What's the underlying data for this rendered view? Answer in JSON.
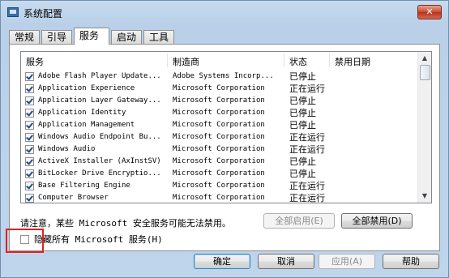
{
  "window": {
    "title": "系统配置",
    "close_label": "✕"
  },
  "tabs": [
    {
      "label": "常规",
      "active": false
    },
    {
      "label": "引导",
      "active": false
    },
    {
      "label": "服务",
      "active": true
    },
    {
      "label": "启动",
      "active": false
    },
    {
      "label": "工具",
      "active": false
    }
  ],
  "columns": {
    "service": "服务",
    "manufacturer": "制造商",
    "status": "状态",
    "disabled_date": "禁用日期"
  },
  "rows": [
    {
      "name": "Adobe Flash Player Update...",
      "manufacturer": "Adobe Systems Incorp...",
      "status": "已停止",
      "checked": true
    },
    {
      "name": "Application Experience",
      "manufacturer": "Microsoft Corporation",
      "status": "正在运行",
      "checked": true
    },
    {
      "name": "Application Layer Gateway...",
      "manufacturer": "Microsoft Corporation",
      "status": "已停止",
      "checked": true
    },
    {
      "name": "Application Identity",
      "manufacturer": "Microsoft Corporation",
      "status": "已停止",
      "checked": true
    },
    {
      "name": "Application Management",
      "manufacturer": "Microsoft Corporation",
      "status": "已停止",
      "checked": true
    },
    {
      "name": "Windows Audio Endpoint Bu...",
      "manufacturer": "Microsoft Corporation",
      "status": "正在运行",
      "checked": true
    },
    {
      "name": "Windows Audio",
      "manufacturer": "Microsoft Corporation",
      "status": "正在运行",
      "checked": true
    },
    {
      "name": "ActiveX Installer (AxInstSV)",
      "manufacturer": "Microsoft Corporation",
      "status": "已停止",
      "checked": true
    },
    {
      "name": "BitLocker Drive Encryptio...",
      "manufacturer": "Microsoft Corporation",
      "status": "已停止",
      "checked": true
    },
    {
      "name": "Base Filtering Engine",
      "manufacturer": "Microsoft Corporation",
      "status": "正在运行",
      "checked": true
    },
    {
      "name": "Computer Browser",
      "manufacturer": "Microsoft Corporation",
      "status": "正在运行",
      "checked": true
    }
  ],
  "note": "请注意，某些 Microsoft 安全服务可能无法禁用。",
  "buttons": {
    "enable_all": "全部启用(E)",
    "disable_all": "全部禁用(D)",
    "ok": "确定",
    "cancel": "取消",
    "apply": "应用(A)",
    "help": "帮助"
  },
  "hide_ms": {
    "label": "隐藏所有 Microsoft 服务(H)",
    "checked": false
  },
  "colors": {
    "highlight": "#e02020",
    "window_bg": "#bfd5ec"
  }
}
